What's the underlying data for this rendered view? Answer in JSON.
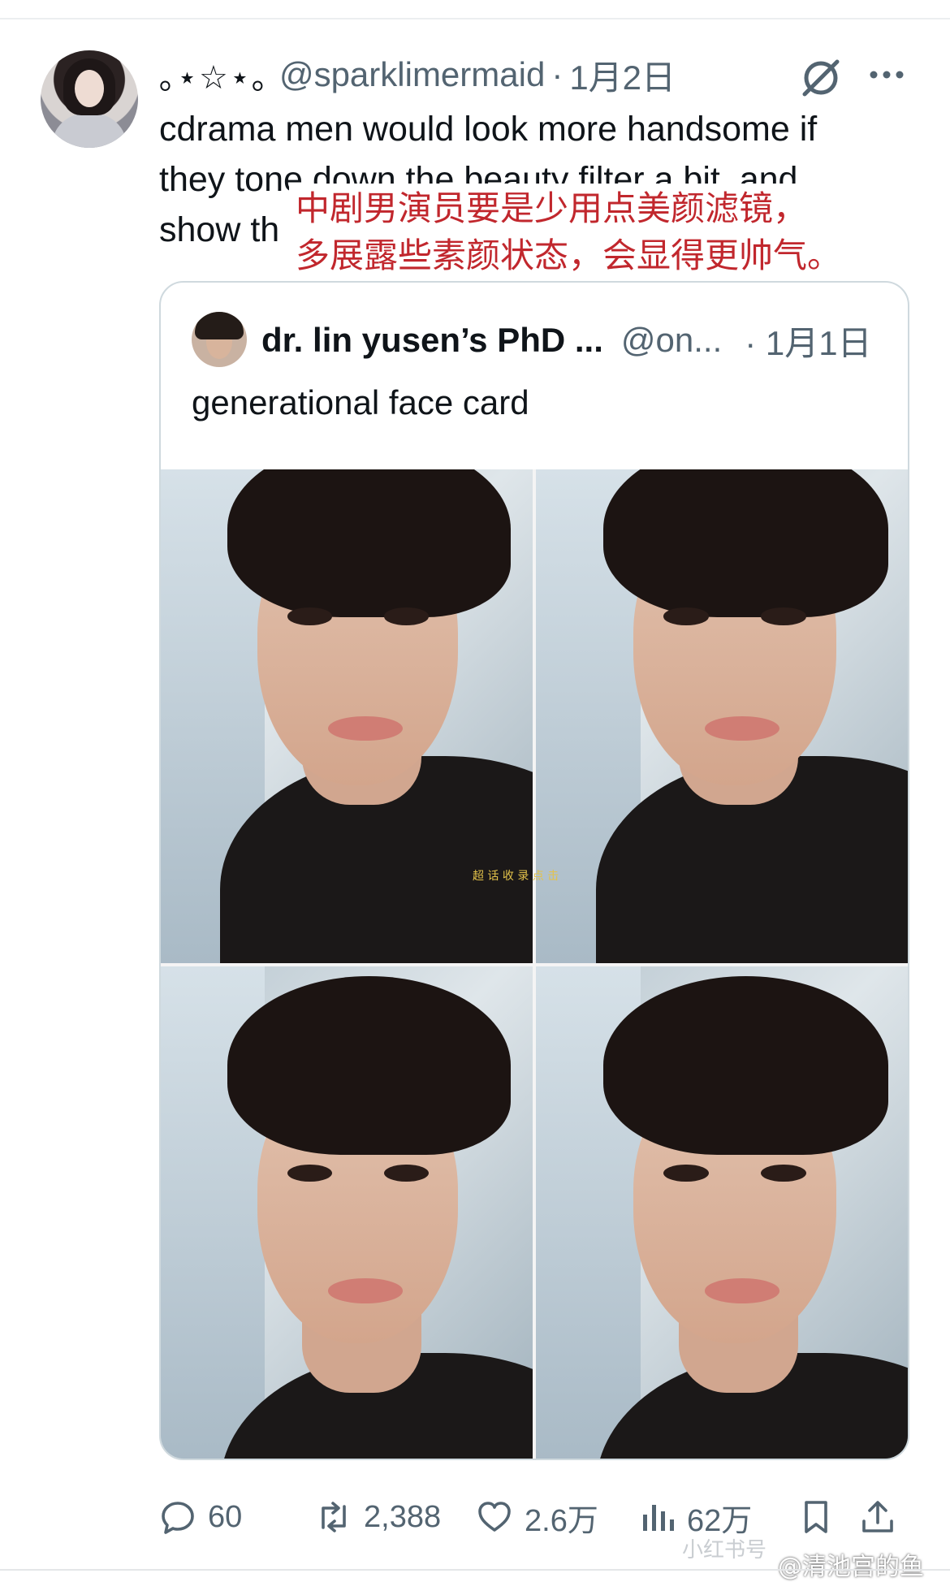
{
  "tweet": {
    "author_display": "｡⋆☆⋆｡",
    "handle": "@sparklimermaid",
    "separator": "·",
    "date": "1月2日",
    "text_lines": [
      "cdrama men would look more handsome if",
      "they tone down the beauty filter a bit, and",
      "show th"
    ]
  },
  "translation_overlay": {
    "lines": [
      "中剧男演员要是少用点美颜滤镜，",
      "多展露些素颜状态，会显得更帅气。"
    ],
    "color": "#c1272d"
  },
  "quoted": {
    "name": "dr. lin yusen’s PhD ...",
    "handle": "@on...",
    "separator": "·",
    "date": "1月1日",
    "text": "generational face card",
    "image_watermark": "超 话 收 录 点 击"
  },
  "actions": {
    "replies": "60",
    "retweets": "2,388",
    "likes": "2.6万",
    "views": "62万"
  },
  "icons": [
    "grok-icon",
    "more-icon",
    "reply-icon",
    "retweet-icon",
    "like-icon",
    "views-icon",
    "bookmark-icon",
    "share-icon"
  ],
  "watermarks": {
    "xiaohongshu": "小红书号",
    "weibo": "@清池宫的鱼"
  }
}
